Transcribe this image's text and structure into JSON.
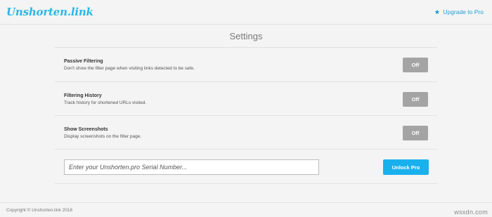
{
  "header": {
    "logo": "Unshorten.link",
    "upgrade_label": "Upgrade to Pro",
    "upgrade_icon": "star-icon"
  },
  "page_title": "Settings",
  "settings": [
    {
      "label": "Passive Filtering",
      "description": "Don't show the filter page when visiting links detected to be safe.",
      "state": "Off"
    },
    {
      "label": "Filtering History",
      "description": "Track history for shortened URLs visited.",
      "state": "Off"
    },
    {
      "label": "Show Screenshots",
      "description": "Display screenshots on the filter page.",
      "state": "Off"
    }
  ],
  "serial": {
    "placeholder": "Enter your Unshorten.pro Serial Number...",
    "value": ""
  },
  "unlock_label": "Unlock Pro",
  "footer": "Copyright © Unshorten.link 2018",
  "watermark": "wsxdn.com",
  "colors": {
    "brand": "#2ab7e6",
    "toggle_off": "#a4a4a4",
    "unlock_button": "#19b0ee",
    "background": "#f4f4f4"
  }
}
